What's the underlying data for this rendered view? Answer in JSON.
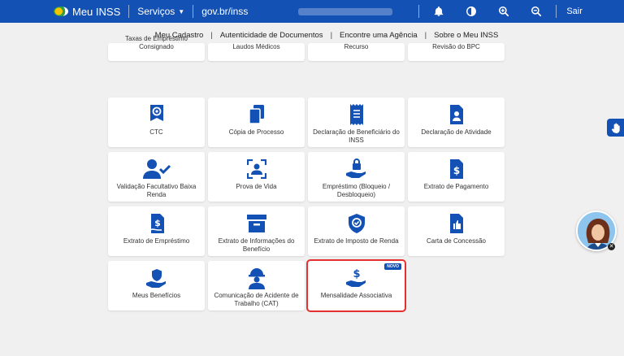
{
  "header": {
    "app_title": "Meu INSS",
    "services_label": "Serviços",
    "govbr_label": "gov.br/inss",
    "exit_label": "Sair",
    "icons": [
      "bell-icon",
      "contrast-icon",
      "zoom-in-icon",
      "zoom-out-icon"
    ]
  },
  "subnav": {
    "items": [
      "Meu Cadastro",
      "Autenticidade de Documentos",
      "Encontre uma Agência",
      "Sobre o Meu INSS"
    ]
  },
  "cards": [
    {
      "label": "Taxas de Empréstimo Consignado"
    },
    {
      "label": "Laudos Médicos"
    },
    {
      "label": "Recurso"
    },
    {
      "label": "Revisão do BPC"
    },
    {
      "label": "CTC",
      "icon": "certificate-icon"
    },
    {
      "label": "Cópia de Processo",
      "icon": "copy-icon"
    },
    {
      "label": "Declaração de Beneficiário do INSS",
      "icon": "receipt-icon"
    },
    {
      "label": "Declaração de Atividade",
      "icon": "badge-document-icon"
    },
    {
      "label": "Validação Facultativo Baixa Renda",
      "icon": "user-check-icon"
    },
    {
      "label": "Prova de Vida",
      "icon": "face-scan-icon"
    },
    {
      "label": "Empréstimo (Bloqueio / Desbloqueio)",
      "icon": "hand-lock-icon"
    },
    {
      "label": "Extrato de Pagamento",
      "icon": "dollar-document-icon"
    },
    {
      "label": "Extrato de Empréstimo",
      "icon": "loan-statement-icon"
    },
    {
      "label": "Extrato de Informações do Benefício",
      "icon": "archive-box-icon"
    },
    {
      "label": "Extrato de Imposto de Renda",
      "icon": "tax-shield-icon"
    },
    {
      "label": "Carta de Concessão",
      "icon": "thumbs-up-document-icon"
    },
    {
      "label": "Meus Benefícios",
      "icon": "hand-shield-icon"
    },
    {
      "label": "Comunicação de Acidente de Trabalho (CAT)",
      "icon": "worker-icon"
    },
    {
      "label": "Mensalidade Associativa",
      "icon": "hand-dollar-icon",
      "badge": "NOVO"
    }
  ],
  "colors": {
    "primary": "#1351b4",
    "highlight": "#e53030",
    "background": "#f0f0f0"
  }
}
